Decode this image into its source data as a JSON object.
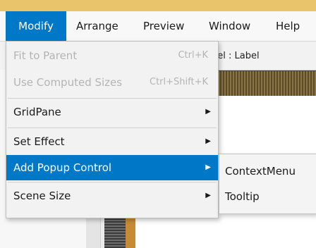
{
  "menubar": {
    "modify": "Modify",
    "arrange": "Arrange",
    "preview": "Preview",
    "window": "Window",
    "help": "Help"
  },
  "canvas": {
    "label_text": "bel : Label"
  },
  "dropdown": {
    "fit_to_parent": "Fit to Parent",
    "fit_to_parent_shortcut": "Ctrl+K",
    "use_computed_sizes": "Use Computed Sizes",
    "use_computed_sizes_shortcut": "Ctrl+Shift+K",
    "gridpane": "GridPane",
    "set_effect": "Set Effect",
    "add_popup_control": "Add Popup Control",
    "scene_size": "Scene Size"
  },
  "submenu": {
    "context_menu": "ContextMenu",
    "tooltip": "Tooltip"
  },
  "colors": {
    "accent": "#0078c8",
    "top_strip": "#e9c46a"
  }
}
